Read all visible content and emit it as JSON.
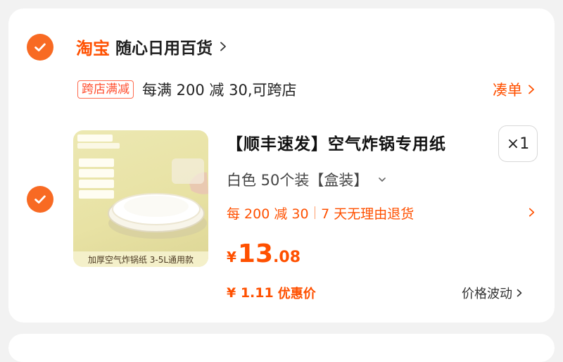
{
  "shop": {
    "platform": "淘宝",
    "name": "随心日用百货"
  },
  "promo": {
    "tag": "跨店满减",
    "text": "每满 200 减 30,可跨店",
    "add_on": "凑单"
  },
  "item": {
    "title": "【顺丰速发】空气炸锅专用纸",
    "quantity": "×1",
    "sku": "白色 50个装【盒装】",
    "benefit_discount": "每 200 减 30",
    "benefit_return": "7 天无理由退货",
    "price_currency": "¥",
    "price_int": "13",
    "price_dec": ".08",
    "discount_price": "¥ 1.11",
    "discount_label": "优惠价",
    "price_fluct": "价格波动",
    "thumb_caption": "加厚空气炸锅纸 3-5L通用款"
  },
  "colors": {
    "accent": "#ff5000",
    "check": "#f86a23"
  },
  "icons": {
    "shop_check": "check-circle-icon",
    "item_check": "check-circle-icon",
    "chevron": "chevron-right-icon",
    "dropdown": "chevron-down-icon"
  }
}
